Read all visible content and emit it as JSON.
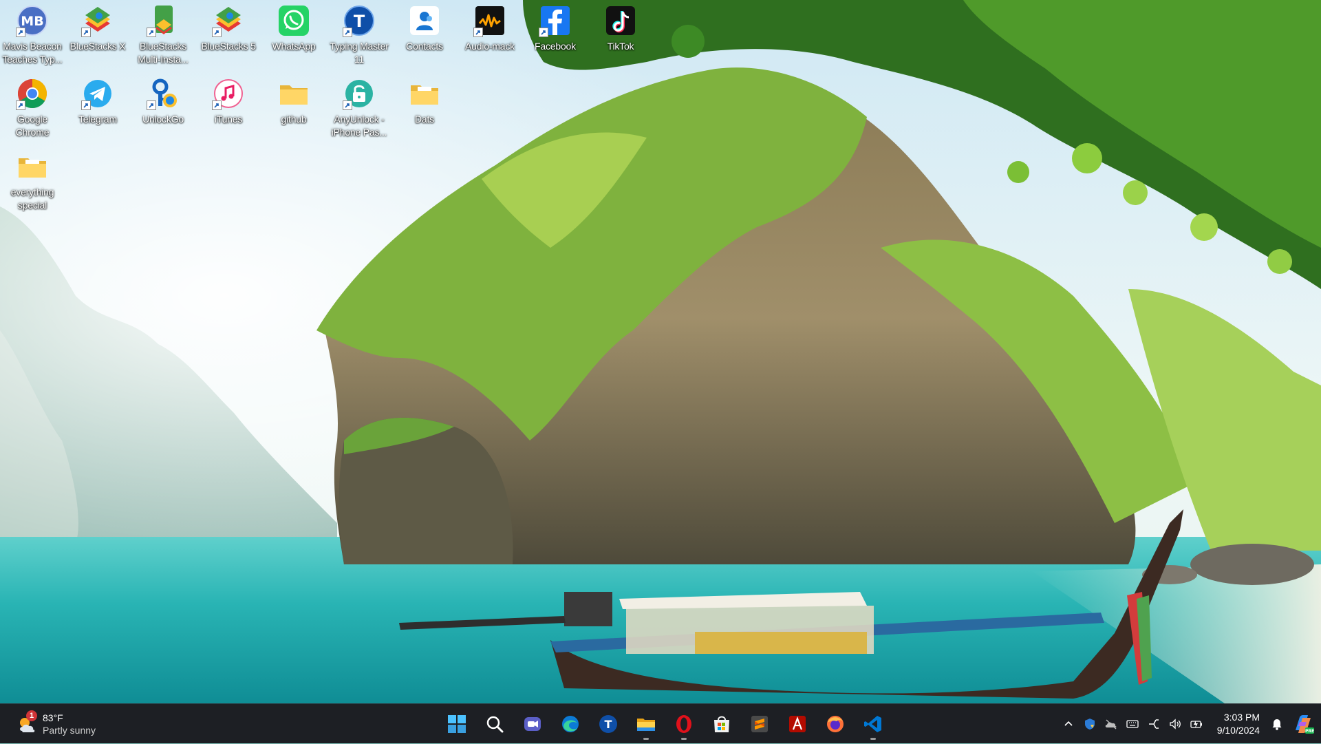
{
  "desktop": {
    "icons": [
      {
        "label": "Mavis Beacon Teaches Typ...",
        "icon": "mavis-beacon-icon",
        "shortcut": true
      },
      {
        "label": "BlueStacks X",
        "icon": "bluestacks-icon",
        "shortcut": true
      },
      {
        "label": "BlueStacks Multi-Insta...",
        "icon": "bluestacks-multi-icon",
        "shortcut": true
      },
      {
        "label": "BlueStacks 5",
        "icon": "bluestacks5-icon",
        "shortcut": true
      },
      {
        "label": "WhatsApp",
        "icon": "whatsapp-icon",
        "shortcut": false
      },
      {
        "label": "Typing Master 11",
        "icon": "typing-master-icon",
        "shortcut": true
      },
      {
        "label": "Contacts",
        "icon": "contacts-icon",
        "shortcut": false
      },
      {
        "label": "Audio-mack",
        "icon": "audiomack-icon",
        "shortcut": true
      },
      {
        "label": "Facebook",
        "icon": "facebook-icon",
        "shortcut": true
      },
      {
        "label": "TikTok",
        "icon": "tiktok-icon",
        "shortcut": false
      },
      {
        "label": "Google Chrome",
        "icon": "chrome-icon",
        "shortcut": true
      },
      {
        "label": "Telegram",
        "icon": "telegram-icon",
        "shortcut": true
      },
      {
        "label": "UnlockGo",
        "icon": "unlockgo-icon",
        "shortcut": true
      },
      {
        "label": "iTunes",
        "icon": "itunes-icon",
        "shortcut": true
      },
      {
        "label": "github",
        "icon": "folder-icon",
        "shortcut": false
      },
      {
        "label": "AnyUnlock - iPhone Pas...",
        "icon": "anyunlock-icon",
        "shortcut": true
      },
      {
        "label": "Dats",
        "icon": "folder-icon",
        "shortcut": false
      },
      {
        "label": "everything special",
        "icon": "folder-icon",
        "shortcut": false
      }
    ]
  },
  "taskbar": {
    "weather": {
      "temp": "83°F",
      "condition": "Partly sunny",
      "badge": "1"
    },
    "apps": [
      {
        "name": "start",
        "icon": "windows-logo-icon",
        "running": false
      },
      {
        "name": "search",
        "icon": "search-icon",
        "running": false
      },
      {
        "name": "meet",
        "icon": "meet-icon",
        "running": false
      },
      {
        "name": "edge",
        "icon": "edge-icon",
        "running": false
      },
      {
        "name": "typing-master",
        "icon": "typing-master-icon",
        "running": false
      },
      {
        "name": "file-explorer",
        "icon": "file-explorer-icon",
        "running": true
      },
      {
        "name": "opera",
        "icon": "opera-icon",
        "running": true
      },
      {
        "name": "store",
        "icon": "microsoft-store-icon",
        "running": false
      },
      {
        "name": "sublime",
        "icon": "sublime-text-icon",
        "running": false
      },
      {
        "name": "acrobat",
        "icon": "acrobat-icon",
        "running": false
      },
      {
        "name": "firefox",
        "icon": "firefox-icon",
        "running": false
      },
      {
        "name": "vscode",
        "icon": "vscode-icon",
        "running": true
      }
    ],
    "tray": {
      "icons": [
        "chevron-up-icon",
        "defender-icon",
        "onedrive-icon",
        "keyboard-icon",
        "network-icon",
        "volume-icon",
        "battery-icon"
      ],
      "time": "3:03 PM",
      "date": "9/10/2024"
    }
  }
}
